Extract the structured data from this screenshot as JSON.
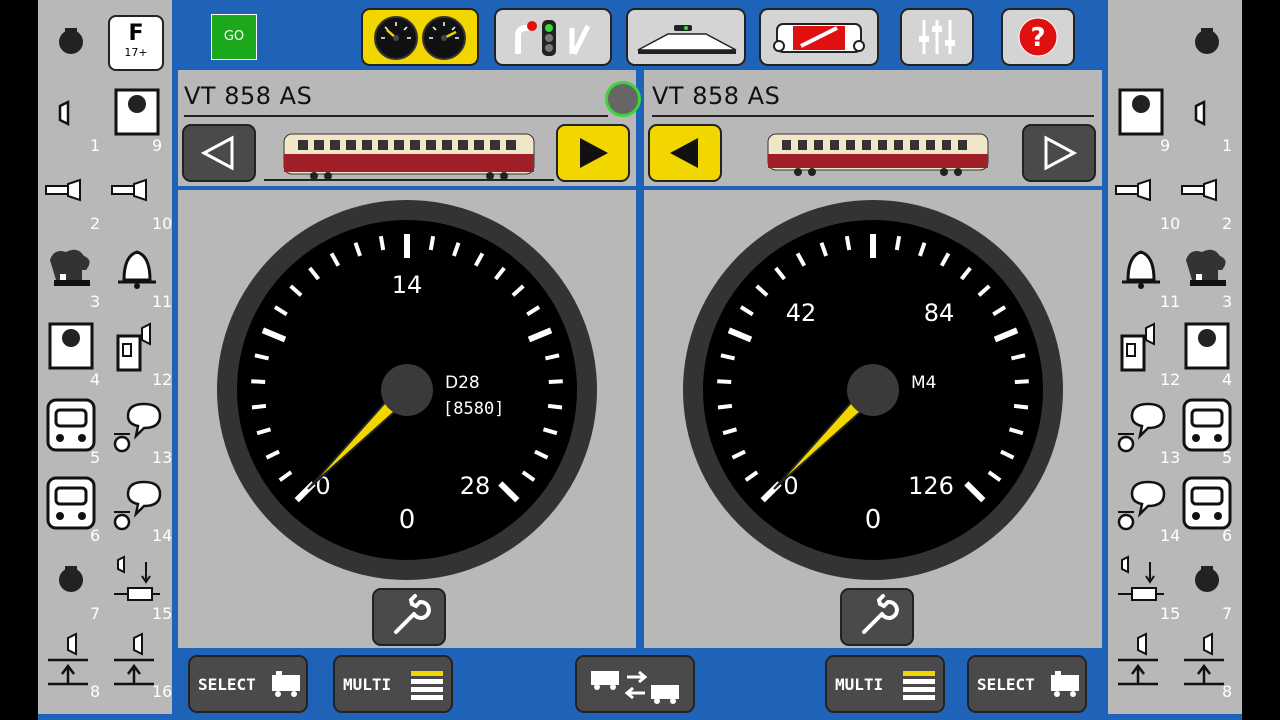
{
  "toolbar": {
    "go_label": "GO",
    "function_key": {
      "title": "F",
      "subtitle": "17+"
    },
    "buttons": [
      {
        "icon": "dual-gauge-icon",
        "active": true
      },
      {
        "icon": "signals-switches-icon",
        "active": false
      },
      {
        "icon": "track-layout-icon",
        "active": false
      },
      {
        "icon": "locomotive-edit-icon",
        "active": false
      },
      {
        "icon": "sliders-icon",
        "active": false
      },
      {
        "icon": "help-icon",
        "active": false
      }
    ]
  },
  "left_functions": [
    {
      "num": "1",
      "icon": "horn-icon"
    },
    {
      "num": "9",
      "icon": "button-icon"
    },
    {
      "num": "2",
      "icon": "whistle-icon"
    },
    {
      "num": "10",
      "icon": "whistle-icon"
    },
    {
      "num": "3",
      "icon": "steam-icon"
    },
    {
      "num": "11",
      "icon": "bell-icon"
    },
    {
      "num": "4",
      "icon": "button-icon"
    },
    {
      "num": "12",
      "icon": "speaker-door-icon"
    },
    {
      "num": "5",
      "icon": "cab-icon"
    },
    {
      "num": "13",
      "icon": "announcement-icon"
    },
    {
      "num": "6",
      "icon": "cab-icon"
    },
    {
      "num": "14",
      "icon": "announcement-icon"
    },
    {
      "num": "7",
      "icon": "dot-icon"
    },
    {
      "num": "15",
      "icon": "coupler-icon"
    },
    {
      "num": "8",
      "icon": "sound-up-icon"
    },
    {
      "num": "16",
      "icon": "sound-up-icon"
    }
  ],
  "right_functions": [
    {
      "num": "9",
      "icon": "button-icon"
    },
    {
      "num": "1",
      "icon": "horn-icon"
    },
    {
      "num": "10",
      "icon": "whistle-icon"
    },
    {
      "num": "2",
      "icon": "whistle-icon"
    },
    {
      "num": "11",
      "icon": "bell-icon"
    },
    {
      "num": "3",
      "icon": "steam-icon"
    },
    {
      "num": "12",
      "icon": "speaker-door-icon"
    },
    {
      "num": "4",
      "icon": "button-icon"
    },
    {
      "num": "13",
      "icon": "announcement-icon"
    },
    {
      "num": "5",
      "icon": "cab-icon"
    },
    {
      "num": "14",
      "icon": "announcement-icon"
    },
    {
      "num": "6",
      "icon": "cab-icon"
    },
    {
      "num": "15",
      "icon": "coupler-icon"
    },
    {
      "num": "7",
      "icon": "dot-icon"
    },
    {
      "num": "",
      "icon": "sound-up-icon"
    },
    {
      "num": "8",
      "icon": "sound-up-icon"
    }
  ],
  "left_cab": {
    "loco_name": "VT 858 AS",
    "direction": "forward",
    "speedometer": {
      "max": 28,
      "labels": [
        "0",
        "14",
        "28"
      ],
      "current_speed": "0",
      "value": 0,
      "decoder": "D28",
      "address": "[8580]"
    }
  },
  "right_cab": {
    "loco_name": "VT 858 AS",
    "direction": "reverse",
    "speedometer": {
      "max": 126,
      "labels": [
        "0",
        "42",
        "84",
        "126"
      ],
      "current_speed": "0",
      "value": 0,
      "decoder": "M4",
      "address": ""
    }
  },
  "bottom_bar": {
    "select_label": "SELECT",
    "multi_label": "MULTI"
  },
  "colors": {
    "frame_blue": "#1e63b8",
    "panel_grey": "#b8b8b8",
    "active_yellow": "#f2d600",
    "go_green": "#1ba81b",
    "help_red": "#e01010"
  }
}
